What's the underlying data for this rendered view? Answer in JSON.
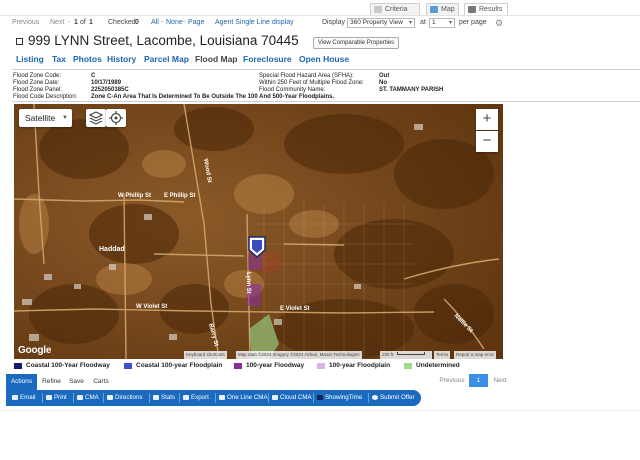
{
  "views": {
    "grid": "Criteria",
    "map": "Map",
    "results": "Results"
  },
  "pager": {
    "previous": "Previous",
    "next": "Next",
    "position": "1",
    "of": "of",
    "total": "1",
    "checked_label": "Checked",
    "checked_count": "0",
    "all": "All",
    "dash1": "-",
    "none": "None",
    "dash2": "-",
    "page": "Page",
    "agent_view": "Agent Single Line display",
    "display_label": "Display",
    "display_value": "360 Property View",
    "at_label": "at",
    "at_value": "1",
    "per_page": "per page"
  },
  "listing": {
    "address": "999 LYNN Street, Lacombe, Louisiana 70445",
    "comparable_button": "View Comparable Properties"
  },
  "tabs": [
    "Listing",
    "Tax",
    "Photos",
    "History",
    "Parcel Map",
    "Flood Map",
    "Foreclosure",
    "Open House"
  ],
  "flood_info": {
    "zone_code_label": "Flood Zone Code:",
    "zone_code": "C",
    "zone_date_label": "Flood Zone Date:",
    "zone_date": "10/17/1989",
    "zone_panel_label": "Flood Zone Panel:",
    "zone_panel": "2252050385C",
    "description_label": "Flood Code Description:",
    "description": "Zone C-An Area That Is Determined To Be Outside The 100 And 500-Year Floodplains.",
    "sfha_label": "Special Flood Hazard Area (SFHA):",
    "sfha": "Out",
    "within250_label": "Within 250 Feet of Multiple Flood Zone:",
    "within250": "No",
    "community_label": "Flood Community Name:",
    "community": "ST. TAMMANY PARISH"
  },
  "map": {
    "map_type": "Satellite",
    "zoom_in": "+",
    "zoom_out": "−",
    "google": "Google",
    "keyboard": "Keyboard shortcuts",
    "map_data": "Map data ©2024 Imagery ©2024 Airbus, Maxar Technologies",
    "scale": "200 ft",
    "terms": "Terms",
    "report": "Report a map error",
    "streets": [
      "W Phillip St",
      "E Phillip St",
      "Haddad",
      "W Violet St",
      "E Violet St",
      "Lynn St",
      "Nellie St",
      "Wood St",
      "Barry St"
    ]
  },
  "legend": [
    {
      "label": "Coastal 100-Year Floodway",
      "color": "#141a6e"
    },
    {
      "label": "Coastal 100-year Floodplain",
      "color": "#3b4fd6"
    },
    {
      "label": "100-year Floodway",
      "color": "#8a2f9a"
    },
    {
      "label": "100-year Floodplain",
      "color": "#d9b3e3"
    },
    {
      "label": "Undetermined",
      "color": "#9ddc8b"
    }
  ],
  "action_tabs": [
    "Actions",
    "Refine",
    "Save",
    "Carts"
  ],
  "paging": {
    "previous": "Previous",
    "current": "1",
    "next": "Next"
  },
  "toolbar": [
    "Email",
    "Print",
    "CMA",
    "Directions",
    "Stats",
    "Export",
    "One Line CMA",
    "Cloud CMA",
    "ShowingTime",
    "Submit Offer"
  ]
}
